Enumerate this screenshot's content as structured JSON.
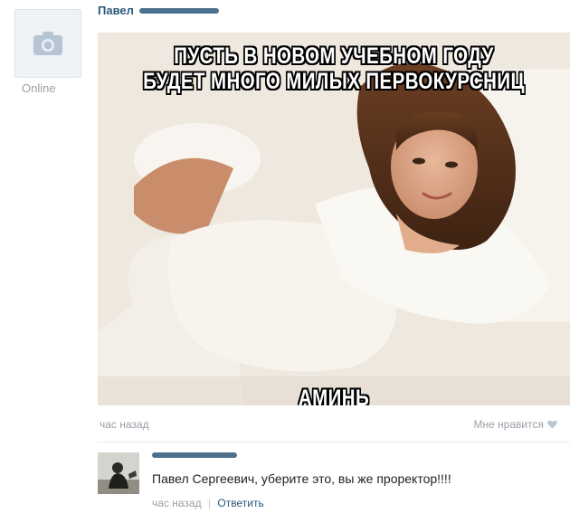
{
  "post": {
    "author": "Павел",
    "status": "Online",
    "caption_top": "ПУСТЬ В НОВОМ УЧЕБНОМ ГОДУ БУДЕТ МНОГО МИЛЫХ ПЕРВОКУРСНИЦ",
    "caption_bottom": "АМИНЬ",
    "time": "час назад",
    "like_label": "Мне нравится"
  },
  "comment": {
    "text": "Павел Сергеевич, уберите это, вы же проректор!!!!",
    "time": "час назад",
    "separator": "|",
    "reply_label": "Ответить"
  },
  "colors": {
    "link": "#2b587a",
    "muted": "#9aa0a8"
  }
}
